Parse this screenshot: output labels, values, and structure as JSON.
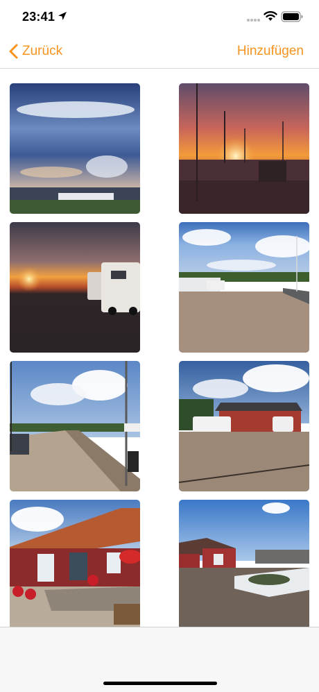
{
  "status_bar": {
    "time": "23:41",
    "icons": [
      "location-arrow-icon",
      "signal-icon",
      "wifi-icon",
      "battery-icon"
    ]
  },
  "nav": {
    "back_label": "Zurück",
    "add_label": "Hinzufügen",
    "tint_color": "#f7931e"
  },
  "photos": [
    {
      "name": "photo-storm-clouds-field"
    },
    {
      "name": "photo-sunset-harbor-masts"
    },
    {
      "name": "photo-sunset-campervans"
    },
    {
      "name": "photo-harbor-path-campervans"
    },
    {
      "name": "photo-boardwalk-pier"
    },
    {
      "name": "photo-campsite-lot-building"
    },
    {
      "name": "photo-red-cabin-flowers"
    },
    {
      "name": "photo-red-cabin-snow"
    }
  ]
}
